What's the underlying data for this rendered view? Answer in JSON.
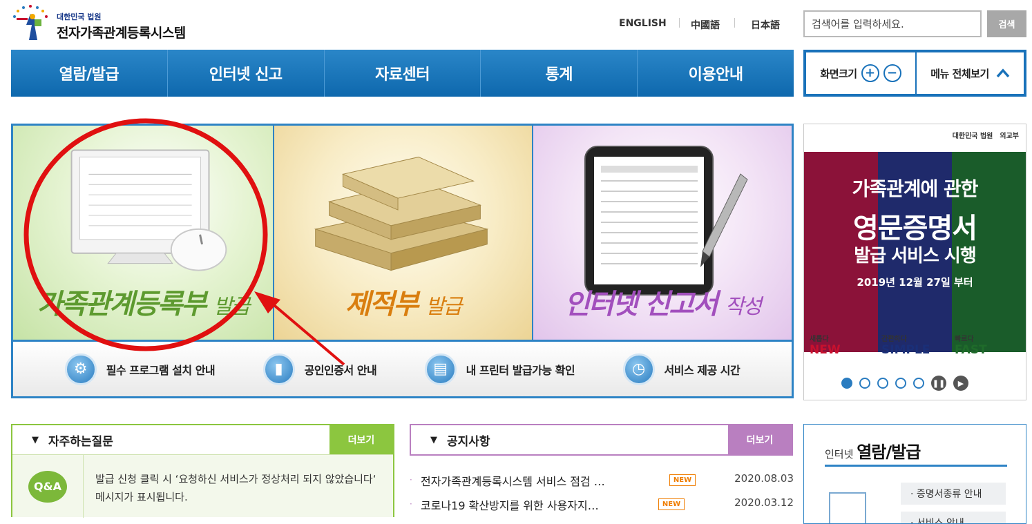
{
  "header": {
    "logo_sub": "대한민국 법원",
    "logo_title": "전자가족관계등록시스템",
    "langs": [
      "ENGLISH",
      "中國語",
      "日本語"
    ],
    "search_placeholder": "검색어를 입력하세요.",
    "search_button": "검색"
  },
  "nav": {
    "items": [
      "열람/발급",
      "인터넷 신고",
      "자료센터",
      "통계",
      "이용안내"
    ]
  },
  "tools": {
    "zoom_label": "화면크기",
    "zoom_in": "+",
    "zoom_out": "−",
    "menu_all": "메뉴 전체보기",
    "menu_icon": "chevron-up-icon"
  },
  "main": {
    "tiles": [
      {
        "title": "가족관계등록부",
        "suffix": "발급",
        "icon": "monitor-mouse-icon"
      },
      {
        "title": "제적부",
        "suffix": "발급",
        "icon": "old-books-icon"
      },
      {
        "title": "인터넷 신고서",
        "suffix": "작성",
        "icon": "tablet-pen-icon"
      }
    ],
    "quick_links": [
      {
        "label": "필수 프로그램 설치 안내",
        "icon": "gear-icon"
      },
      {
        "label": "공인인증서 안내",
        "icon": "usb-icon"
      },
      {
        "label": "내 프린터 발급가능 확인",
        "icon": "printer-icon"
      },
      {
        "label": "서비스 제공 시간",
        "icon": "clock-icon"
      }
    ],
    "annotation_color": "#e01010"
  },
  "side_banner": {
    "org1": "대한민국 법원",
    "org2": "외교부",
    "line1": "가족관계에 관한",
    "line2": "영문증명서",
    "line3": "발급 서비스 시행",
    "line4": "2019년 12월 27일 부터",
    "words": [
      {
        "ko": "새롭다",
        "en": "NEW",
        "color": "#c8102e"
      },
      {
        "ko": "간편하다",
        "en": "SIMPLE",
        "color": "#1a2f78"
      },
      {
        "ko": "빠르다",
        "en": "FAST",
        "color": "#1f6b2a"
      }
    ],
    "stripe_colors": [
      "#8b1239",
      "#1f2a6b",
      "#1a5c2a"
    ],
    "active_slide": 1,
    "slides": 5
  },
  "faq": {
    "title": "자주하는질문",
    "more": "더보기",
    "icon_text": "Q&A",
    "text": "발급 신청 클릭 시 ‘요청하신 서비스가 정상처리 되지 않았습니다‘ 메시지가 표시됩니다.",
    "accent": "#8cc63f"
  },
  "notice": {
    "title": "공지사항",
    "more": "더보기",
    "accent": "#b97fc0",
    "new_label": "NEW",
    "items": [
      {
        "title": "전자가족관계등록시스템 서비스 점검 …",
        "date": "2020.08.03"
      },
      {
        "title": "코로나19 확산방지를 위한 사용자지…",
        "date": "2020.03.12"
      }
    ]
  },
  "internet": {
    "prefix": "인터넷",
    "title": "열람/발급",
    "links": [
      "· 증명서종류 안내",
      "· 서비스 안내"
    ]
  }
}
